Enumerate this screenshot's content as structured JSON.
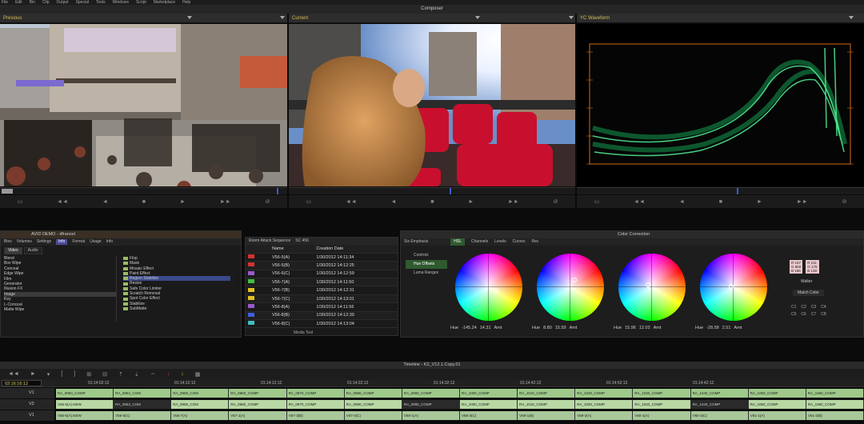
{
  "menu": [
    "File",
    "Edit",
    "Bin",
    "Clip",
    "Output",
    "Special",
    "Tools",
    "Windows",
    "Script",
    "Marketplace",
    "Help"
  ],
  "window_title": "Composer",
  "monitors": {
    "previous": "Previous",
    "current": "Current",
    "waveform": "YC Waveform"
  },
  "controls_glyphs": [
    "▭",
    "◄◄",
    "◄",
    "■",
    "►",
    "►►",
    "⊘"
  ],
  "project": {
    "title": "AVID DEMO - dfranzel",
    "tabs": [
      "Bins",
      "Volumes",
      "Settings",
      "Info",
      "Format",
      "Usage",
      "Info"
    ],
    "subtabs": [
      "Video",
      "Audio"
    ],
    "categories": [
      "Blend",
      "Box Wipe",
      "Conceal",
      "Edge Wipe",
      "Film",
      "Generator",
      "Illusion FX",
      "Image",
      "Key",
      "L-Conceal",
      "Matte Wipe"
    ],
    "effects": [
      "Flop",
      "Mask",
      "Mosaic Effect",
      "Paint Effect",
      "Region Stabilize",
      "Resize",
      "Safe Color Limiter",
      "Scratch Removal",
      "Spot Color Effect",
      "Stabilize",
      "SubMatte"
    ]
  },
  "bin": {
    "tab1": "Room Attack Sequence",
    "tab2": "SC 456",
    "title": "SC 456",
    "col_name": "Name",
    "col_date": "Creation Date",
    "rows": [
      {
        "name": "V56-5(A)",
        "date": "1/30/2012 14:11:34",
        "color": "#d83030"
      },
      {
        "name": "V56-5(B)",
        "date": "1/30/2012 14:12:25",
        "color": "#d83030"
      },
      {
        "name": "V56-6(C)",
        "date": "1/30/2012 14:12:59",
        "color": "#9b59d0"
      },
      {
        "name": "V56-7(A)",
        "date": "1/30/2012 14:11:50",
        "color": "#40c040"
      },
      {
        "name": "V56-7(B)",
        "date": "1/30/2012 14:12:31",
        "color": "#e0c020"
      },
      {
        "name": "V56-7(C)",
        "date": "1/30/2012 14:13:01",
        "color": "#e0c020"
      },
      {
        "name": "V56-8(A)",
        "date": "1/30/2012 14:11:56",
        "color": "#9b59d0"
      },
      {
        "name": "V56-8(B)",
        "date": "1/30/2012 14:12:39",
        "color": "#4060e0"
      },
      {
        "name": "V56-8(C)",
        "date": "1/30/2012 14:13:04",
        "color": "#40c0c0"
      }
    ],
    "footer_tool": "Media Tool"
  },
  "color_correction": {
    "title": "Color Correction",
    "mode": "Six Emphasis",
    "tabs": [
      "HSL",
      "Channels",
      "Levels",
      "Curves",
      "Rec"
    ],
    "sections": [
      "Controls",
      "Hue Offsets",
      "Luma Ranges"
    ],
    "wheels": [
      {
        "label": "Hue",
        "v1": "-145.24",
        "v2": "14.31",
        "amt": "Amt"
      },
      {
        "label": "Hue",
        "v1": "8.80",
        "v2": "15.59",
        "amt": "Amt"
      },
      {
        "label": "Hue",
        "v1": "15.96",
        "v2": "12.02",
        "amt": "Amt"
      },
      {
        "label": "Hue",
        "v1": "-28.58",
        "v2": "2.51",
        "amt": "Amt"
      }
    ],
    "readout_left": [
      "R 167",
      "G 860",
      "B 186"
    ],
    "readout_right": [
      "R 211",
      "G 176",
      "B 138"
    ],
    "match_label": "Match Color",
    "match_mode": "Walter",
    "slots": [
      "C1",
      "C2",
      "C3",
      "C4",
      "C5",
      "C6",
      "C7",
      "C8"
    ]
  },
  "timeline": {
    "title": "Timeline - K2_V12.1.Copy.01",
    "timecode": "03:16:16:12",
    "ruler": [
      "01:14:02:12",
      "01:14:12:12",
      "01:14:12:12",
      "01:14:22:12",
      "01:14:32:12",
      "01:14:42:12",
      "01:14:52:12",
      "01:14:42:12"
    ],
    "tracks": [
      {
        "label": "V1",
        "clips": [
          "RA_0950_COMP",
          "RA_0953_COM",
          "RA_0959_COM",
          "RA_0960_COMP",
          "RA_0970_COMP",
          "RA_0980_COMP",
          "RA_0990_COMP",
          "RA_1000_COMP",
          "RA_1010_COMP",
          "RA_1020_COMP",
          "RA_1030_COMP",
          "RA_1040_COMP",
          "RA_1050_COMP",
          "RA_1060_COMP"
        ]
      },
      {
        "label": "V2",
        "clips": [
          "V56-5(A).NEW",
          "RA_0953_COM",
          "RA_0959_COM",
          "RA_0960_COMP",
          "RA_0970_COMP",
          "RA_0980_COMP",
          "RA_0990_COMP",
          "RA_1000_COMP",
          "RA_1010_COMP",
          "RA_1020_COMP",
          "RA_1030_COMP",
          "RA_1040_COMP",
          "RA_1050_COMP",
          "RA_1060_COMP"
        ]
      },
      {
        "label": "V1",
        "clips": [
          "V56-5(A).NEW",
          "V56-6(C)",
          "V56-7(A)",
          "V57-1(A)",
          "V57-3(B)",
          "V57-4(C)",
          "V58-1(A)",
          "V58-3(C)",
          "V59-1(B)",
          "V59-2(A)",
          "V60-1(A)",
          "V60-3(C)",
          "V61-1(A)",
          "V61-2(B)"
        ]
      }
    ]
  }
}
